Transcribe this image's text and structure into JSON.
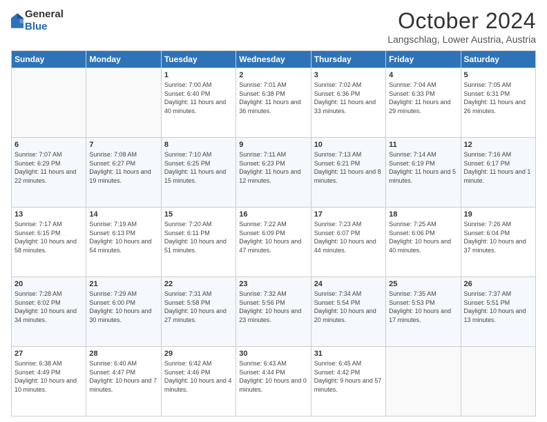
{
  "header": {
    "logo": {
      "line1": "General",
      "line2": "Blue"
    },
    "title": "October 2024",
    "location": "Langschlag, Lower Austria, Austria"
  },
  "weekdays": [
    "Sunday",
    "Monday",
    "Tuesday",
    "Wednesday",
    "Thursday",
    "Friday",
    "Saturday"
  ],
  "weeks": [
    [
      {
        "day": "",
        "info": ""
      },
      {
        "day": "",
        "info": ""
      },
      {
        "day": "1",
        "info": "Sunrise: 7:00 AM\nSunset: 6:40 PM\nDaylight: 11 hours and 40 minutes."
      },
      {
        "day": "2",
        "info": "Sunrise: 7:01 AM\nSunset: 6:38 PM\nDaylight: 11 hours and 36 minutes."
      },
      {
        "day": "3",
        "info": "Sunrise: 7:02 AM\nSunset: 6:36 PM\nDaylight: 11 hours and 33 minutes."
      },
      {
        "day": "4",
        "info": "Sunrise: 7:04 AM\nSunset: 6:33 PM\nDaylight: 11 hours and 29 minutes."
      },
      {
        "day": "5",
        "info": "Sunrise: 7:05 AM\nSunset: 6:31 PM\nDaylight: 11 hours and 26 minutes."
      }
    ],
    [
      {
        "day": "6",
        "info": "Sunrise: 7:07 AM\nSunset: 6:29 PM\nDaylight: 11 hours and 22 minutes."
      },
      {
        "day": "7",
        "info": "Sunrise: 7:08 AM\nSunset: 6:27 PM\nDaylight: 11 hours and 19 minutes."
      },
      {
        "day": "8",
        "info": "Sunrise: 7:10 AM\nSunset: 6:25 PM\nDaylight: 11 hours and 15 minutes."
      },
      {
        "day": "9",
        "info": "Sunrise: 7:11 AM\nSunset: 6:23 PM\nDaylight: 11 hours and 12 minutes."
      },
      {
        "day": "10",
        "info": "Sunrise: 7:13 AM\nSunset: 6:21 PM\nDaylight: 11 hours and 8 minutes."
      },
      {
        "day": "11",
        "info": "Sunrise: 7:14 AM\nSunset: 6:19 PM\nDaylight: 11 hours and 5 minutes."
      },
      {
        "day": "12",
        "info": "Sunrise: 7:16 AM\nSunset: 6:17 PM\nDaylight: 11 hours and 1 minute."
      }
    ],
    [
      {
        "day": "13",
        "info": "Sunrise: 7:17 AM\nSunset: 6:15 PM\nDaylight: 10 hours and 58 minutes."
      },
      {
        "day": "14",
        "info": "Sunrise: 7:19 AM\nSunset: 6:13 PM\nDaylight: 10 hours and 54 minutes."
      },
      {
        "day": "15",
        "info": "Sunrise: 7:20 AM\nSunset: 6:11 PM\nDaylight: 10 hours and 51 minutes."
      },
      {
        "day": "16",
        "info": "Sunrise: 7:22 AM\nSunset: 6:09 PM\nDaylight: 10 hours and 47 minutes."
      },
      {
        "day": "17",
        "info": "Sunrise: 7:23 AM\nSunset: 6:07 PM\nDaylight: 10 hours and 44 minutes."
      },
      {
        "day": "18",
        "info": "Sunrise: 7:25 AM\nSunset: 6:06 PM\nDaylight: 10 hours and 40 minutes."
      },
      {
        "day": "19",
        "info": "Sunrise: 7:26 AM\nSunset: 6:04 PM\nDaylight: 10 hours and 37 minutes."
      }
    ],
    [
      {
        "day": "20",
        "info": "Sunrise: 7:28 AM\nSunset: 6:02 PM\nDaylight: 10 hours and 34 minutes."
      },
      {
        "day": "21",
        "info": "Sunrise: 7:29 AM\nSunset: 6:00 PM\nDaylight: 10 hours and 30 minutes."
      },
      {
        "day": "22",
        "info": "Sunrise: 7:31 AM\nSunset: 5:58 PM\nDaylight: 10 hours and 27 minutes."
      },
      {
        "day": "23",
        "info": "Sunrise: 7:32 AM\nSunset: 5:56 PM\nDaylight: 10 hours and 23 minutes."
      },
      {
        "day": "24",
        "info": "Sunrise: 7:34 AM\nSunset: 5:54 PM\nDaylight: 10 hours and 20 minutes."
      },
      {
        "day": "25",
        "info": "Sunrise: 7:35 AM\nSunset: 5:53 PM\nDaylight: 10 hours and 17 minutes."
      },
      {
        "day": "26",
        "info": "Sunrise: 7:37 AM\nSunset: 5:51 PM\nDaylight: 10 hours and 13 minutes."
      }
    ],
    [
      {
        "day": "27",
        "info": "Sunrise: 6:38 AM\nSunset: 4:49 PM\nDaylight: 10 hours and 10 minutes."
      },
      {
        "day": "28",
        "info": "Sunrise: 6:40 AM\nSunset: 4:47 PM\nDaylight: 10 hours and 7 minutes."
      },
      {
        "day": "29",
        "info": "Sunrise: 6:42 AM\nSunset: 4:46 PM\nDaylight: 10 hours and 4 minutes."
      },
      {
        "day": "30",
        "info": "Sunrise: 6:43 AM\nSunset: 4:44 PM\nDaylight: 10 hours and 0 minutes."
      },
      {
        "day": "31",
        "info": "Sunrise: 6:45 AM\nSunset: 4:42 PM\nDaylight: 9 hours and 57 minutes."
      },
      {
        "day": "",
        "info": ""
      },
      {
        "day": "",
        "info": ""
      }
    ]
  ]
}
